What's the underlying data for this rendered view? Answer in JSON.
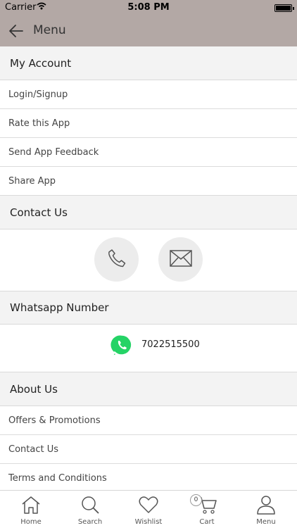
{
  "status_bar": {
    "carrier": "Carrier",
    "time": "5:08 PM"
  },
  "nav": {
    "title": "Menu"
  },
  "my_account": {
    "title": "My Account",
    "items": [
      {
        "label": "Login/Signup"
      },
      {
        "label": "Rate this App"
      },
      {
        "label": "Send App Feedback"
      },
      {
        "label": "Share App"
      }
    ]
  },
  "contact": {
    "title": "Contact Us"
  },
  "whatsapp": {
    "title": "Whatsapp Number",
    "number": "7022515500"
  },
  "about": {
    "title": "About Us",
    "items": [
      {
        "label": "Offers & Promotions"
      },
      {
        "label": "Contact Us"
      },
      {
        "label": "Terms and Conditions"
      }
    ]
  },
  "tabs": [
    {
      "label": "Home",
      "icon": "home-icon"
    },
    {
      "label": "Search",
      "icon": "search-icon"
    },
    {
      "label": "Wishlist",
      "icon": "heart-icon"
    },
    {
      "label": "Cart",
      "icon": "cart-icon",
      "badge": "0"
    },
    {
      "label": "Menu",
      "icon": "person-icon"
    }
  ],
  "colors": {
    "nav_background": "#b3a8a5",
    "section_background": "#f3f3f3",
    "whatsapp_green": "#25d366"
  }
}
